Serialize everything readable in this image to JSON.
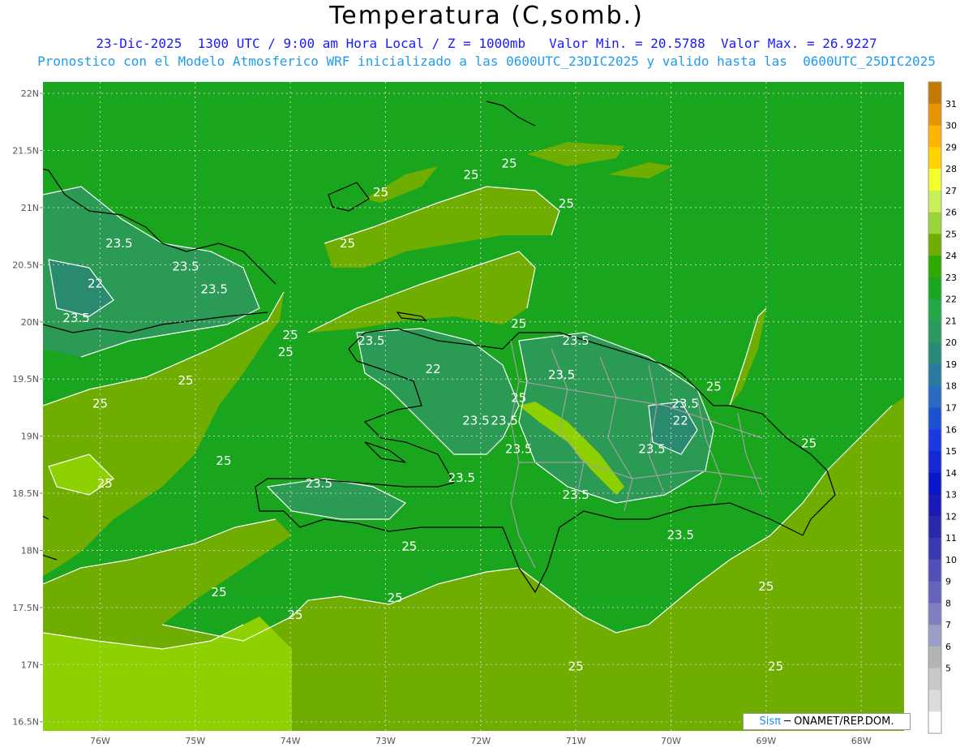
{
  "header": {
    "title": "Temperatura (C,somb.)",
    "line1": "23-Dic-2025  1300 UTC / 9:00 am Hora Local / Z = 1000mb   Valor Min. = 20.5788  Valor Max. = 26.9227",
    "line2": "Pronostico con el Modelo Atmosferico WRF inicializado a las 0600UTC_23DIC2025 y valido hasta las  0600UTC_25DIC2025"
  },
  "axes": {
    "lat_labels": [
      "22N",
      "21.5N",
      "21N",
      "20.5N",
      "20N",
      "19.5N",
      "19N",
      "18.5N",
      "18N",
      "17.5N",
      "17N",
      "16.5N"
    ],
    "lon_labels": [
      "76W",
      "75W",
      "74W",
      "73W",
      "72W",
      "71W",
      "70W",
      "69W",
      "68W"
    ]
  },
  "colorbar": {
    "labels": [
      "31",
      "30",
      "29",
      "28",
      "27",
      "26",
      "25",
      "24",
      "23",
      "22",
      "21",
      "20",
      "19",
      "18",
      "17",
      "16",
      "15",
      "14",
      "13",
      "12",
      "11",
      "10",
      "9",
      "8",
      "7",
      "6",
      "5"
    ],
    "colors": [
      "#c47a00",
      "#e59400",
      "#ffb400",
      "#ffd200",
      "#f5ff2e",
      "#c8f05a",
      "#9ad23a",
      "#6fae00",
      "#2eaa00",
      "#1aa51e",
      "#22a84a",
      "#2a9a5f",
      "#2a8a7a",
      "#2a7aa0",
      "#2a6ac0",
      "#1e50d2",
      "#1a3ae0",
      "#1428d2",
      "#0a14c8",
      "#1a1ab4",
      "#2828aa",
      "#3a3ab0",
      "#5050b8",
      "#6464b8",
      "#8080c0",
      "#9c9cc8",
      "#b4b4b4",
      "#c8c8c8",
      "#dcdcdc",
      "#ffffff"
    ]
  },
  "field_colors": {
    "c24": "#1aa51e",
    "c25": "#6fae00",
    "c26": "#8fd000",
    "c23": "#2a9a55",
    "c22": "#2a8a70"
  },
  "contour_labels": [
    {
      "text": "25",
      "lon": -73.05,
      "lat": 21.1
    },
    {
      "text": "25",
      "lon": -72.1,
      "lat": 21.25
    },
    {
      "text": "25",
      "lon": -71.7,
      "lat": 21.35
    },
    {
      "text": "25",
      "lon": -71.1,
      "lat": 21.0
    },
    {
      "text": "25",
      "lon": -73.4,
      "lat": 20.65
    },
    {
      "text": "23.5",
      "lon": -75.8,
      "lat": 20.65
    },
    {
      "text": "23.5",
      "lon": -75.1,
      "lat": 20.45
    },
    {
      "text": "23.5",
      "lon": -74.8,
      "lat": 20.25
    },
    {
      "text": "22",
      "lon": -76.05,
      "lat": 20.3
    },
    {
      "text": "23.5",
      "lon": -76.25,
      "lat": 20.0
    },
    {
      "text": "25",
      "lon": -74.0,
      "lat": 19.85
    },
    {
      "text": "25",
      "lon": -74.05,
      "lat": 19.7
    },
    {
      "text": "25",
      "lon": -75.1,
      "lat": 19.45
    },
    {
      "text": "25",
      "lon": -76.0,
      "lat": 19.25
    },
    {
      "text": "23.5",
      "lon": -73.15,
      "lat": 19.8
    },
    {
      "text": "22",
      "lon": -72.5,
      "lat": 19.55
    },
    {
      "text": "25",
      "lon": -71.6,
      "lat": 19.95
    },
    {
      "text": "23.5",
      "lon": -71.0,
      "lat": 19.8
    },
    {
      "text": "23.5",
      "lon": -71.15,
      "lat": 19.5
    },
    {
      "text": "25",
      "lon": -71.6,
      "lat": 19.3
    },
    {
      "text": "23.5",
      "lon": -72.05,
      "lat": 19.1
    },
    {
      "text": "23.5",
      "lon": -71.75,
      "lat": 19.1
    },
    {
      "text": "23.5",
      "lon": -71.6,
      "lat": 18.85
    },
    {
      "text": "23.5",
      "lon": -72.2,
      "lat": 18.6
    },
    {
      "text": "23.5",
      "lon": -73.7,
      "lat": 18.55
    },
    {
      "text": "23.5",
      "lon": -70.2,
      "lat": 18.85
    },
    {
      "text": "23.5",
      "lon": -71.0,
      "lat": 18.45
    },
    {
      "text": "23.5",
      "lon": -69.85,
      "lat": 19.25
    },
    {
      "text": "22",
      "lon": -69.9,
      "lat": 19.1
    },
    {
      "text": "25",
      "lon": -69.55,
      "lat": 19.4
    },
    {
      "text": "25",
      "lon": -68.55,
      "lat": 18.9
    },
    {
      "text": "23.5",
      "lon": -69.9,
      "lat": 18.1
    },
    {
      "text": "25",
      "lon": -75.95,
      "lat": 18.55
    },
    {
      "text": "25",
      "lon": -74.7,
      "lat": 18.75
    },
    {
      "text": "25",
      "lon": -72.75,
      "lat": 18.0
    },
    {
      "text": "25",
      "lon": -69.0,
      "lat": 17.65
    },
    {
      "text": "25",
      "lon": -74.75,
      "lat": 17.6
    },
    {
      "text": "25",
      "lon": -73.95,
      "lat": 17.4
    },
    {
      "text": "25",
      "lon": -72.9,
      "lat": 17.55
    },
    {
      "text": "25",
      "lon": -68.9,
      "lat": 16.95
    },
    {
      "text": "25",
      "lon": -71.0,
      "lat": 16.95
    }
  ],
  "credit": {
    "brand": "Sisπ",
    "org": " ─ ONAMET/REP.DOM."
  }
}
